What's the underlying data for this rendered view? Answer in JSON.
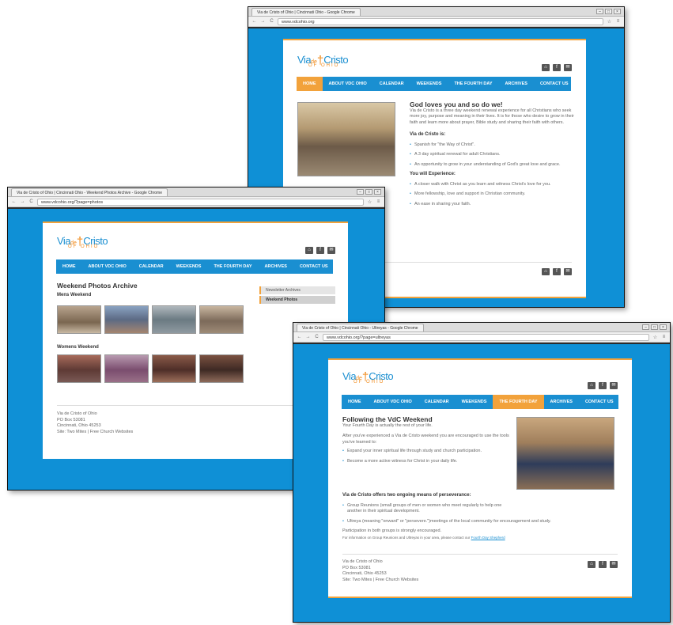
{
  "browser_top": {
    "tab_title": "Via de Cristo of Ohio | Cincinnati Ohio - Google Chrome",
    "address": "www.vdcohio.org"
  },
  "browser_left": {
    "tab_title": "Via de Cristo of Ohio | Cincinnati Ohio - Weekend Photos Archive - Google Chrome",
    "address": "www.vdcohio.org/?page=photos"
  },
  "browser_right": {
    "tab_title": "Via de Cristo of Ohio | Cincinnati Ohio - Ultreyas - Google Chrome",
    "address": "www.vdcohio.org/?page=ultreyas"
  },
  "logo": {
    "via": "Via",
    "de": "de",
    "cristo": "Cristo",
    "ohio": "OF OHIO"
  },
  "nav": {
    "home": "HOME",
    "about": "ABOUT VDC OHIO",
    "calendar": "CALENDAR",
    "weekends": "WEEKENDS",
    "fourth_day": "THE FOURTH DAY",
    "archives": "ARCHIVES",
    "contact": "CONTACT US"
  },
  "social": {
    "home_glyph": "⌂",
    "facebook_glyph": "f",
    "mail_glyph": "✉"
  },
  "home_page": {
    "heading": "God loves you and so do we!",
    "intro": "Via de Cristo is a three day weekend renewal experience for all Christians who seek more joy, purpose and meaning in their lives. It is for those who desire to grow in their faith and learn more about prayer, Bible study and sharing their faith with others.",
    "is_heading": "Via de Cristo is:",
    "is_items": [
      "Spanish for \"the Way of Christ\".",
      "A 3 day spiritual renewal for adult Christians.",
      "An opportunity to grow in your understanding of God's great love and grace."
    ],
    "exp_heading": "You will Experience:",
    "exp_items": [
      "A closer walk with Christ as you learn and witness Christ's love for you.",
      "More fellowship, love and support in Christian community.",
      "An ease in sharing your faith."
    ]
  },
  "photos_page": {
    "heading": "Weekend Photos Archive",
    "mens": "Mens Weekend",
    "womens": "Womens Weekend",
    "sidebar_1": "Newsletter Archives",
    "sidebar_2": "Weekend Photos",
    "footer_name": "Via de Cristo of Ohio",
    "footer_box": "PO Box 53081",
    "footer_city": "Cincinnati, Ohio 45253",
    "footer_site": "Site: Two Mites  |  Free Church Websites"
  },
  "ultreya_page": {
    "heading": "Following the VdC Weekend",
    "subheading": "Your Fourth Day is actually the rest of your life.",
    "intro": "After you've experienced a Via de Cristo weekend you are encouraged to use the tools you've learned to:",
    "items1": [
      "Expand your inner spiritual life through study and church participation.",
      "Become a more active witness for Christ in your daily life."
    ],
    "offers_heading": "Via de Cristo offers two ongoing means of perseverance:",
    "items2": [
      "Group Reunions (small groups of men or women who meet regularly to help one another in their spiritual development.",
      "Ultreya (meaning \"onward\" or \"persevere.\")meetings of the local community for encouragement and study."
    ],
    "participation": "Participation in both groups is strongly encouraged.",
    "info_prefix": "For information on Group Reunions and Ultreyas in your area, please contact our",
    "info_link": "Fourth Day Shepherd",
    "footer_name": "Via de Cristo of Ohio",
    "footer_box": "PO Box 53081",
    "footer_city": "Cincinnati, Ohio 45253",
    "footer_site": "Site: Two Mites  |  Free Church Websites"
  },
  "colors": {
    "brand_blue": "#1a8fd1",
    "accent_orange": "#f2a23b",
    "background_blue": "#0f90d6"
  }
}
